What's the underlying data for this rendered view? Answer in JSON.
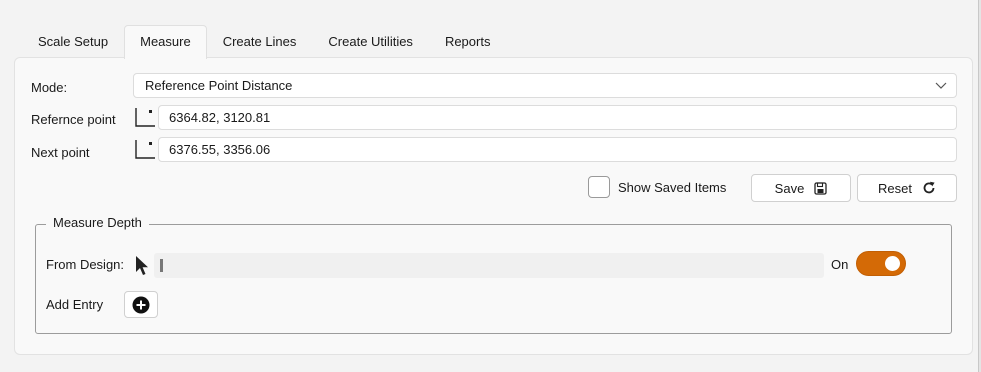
{
  "tabs": [
    {
      "label": "Scale Setup"
    },
    {
      "label": "Measure"
    },
    {
      "label": "Create Lines"
    },
    {
      "label": "Create Utilities"
    },
    {
      "label": "Reports"
    }
  ],
  "active_tab": "Measure",
  "mode": {
    "label": "Mode:",
    "value": "Reference Point Distance"
  },
  "reference_point": {
    "label": "Refernce point",
    "value": "6364.82, 3120.81"
  },
  "next_point": {
    "label": "Next point",
    "value": "6376.55, 3356.06"
  },
  "show_saved": {
    "label": "Show Saved Items",
    "checked": false
  },
  "buttons": {
    "save": "Save",
    "reset": "Reset"
  },
  "measure_depth": {
    "title": "Measure Depth",
    "from_design_label": "From Design:",
    "toggle_label": "On",
    "toggle_on": true,
    "add_entry_label": "Add Entry"
  },
  "colors": {
    "accent": "#d46a06"
  }
}
